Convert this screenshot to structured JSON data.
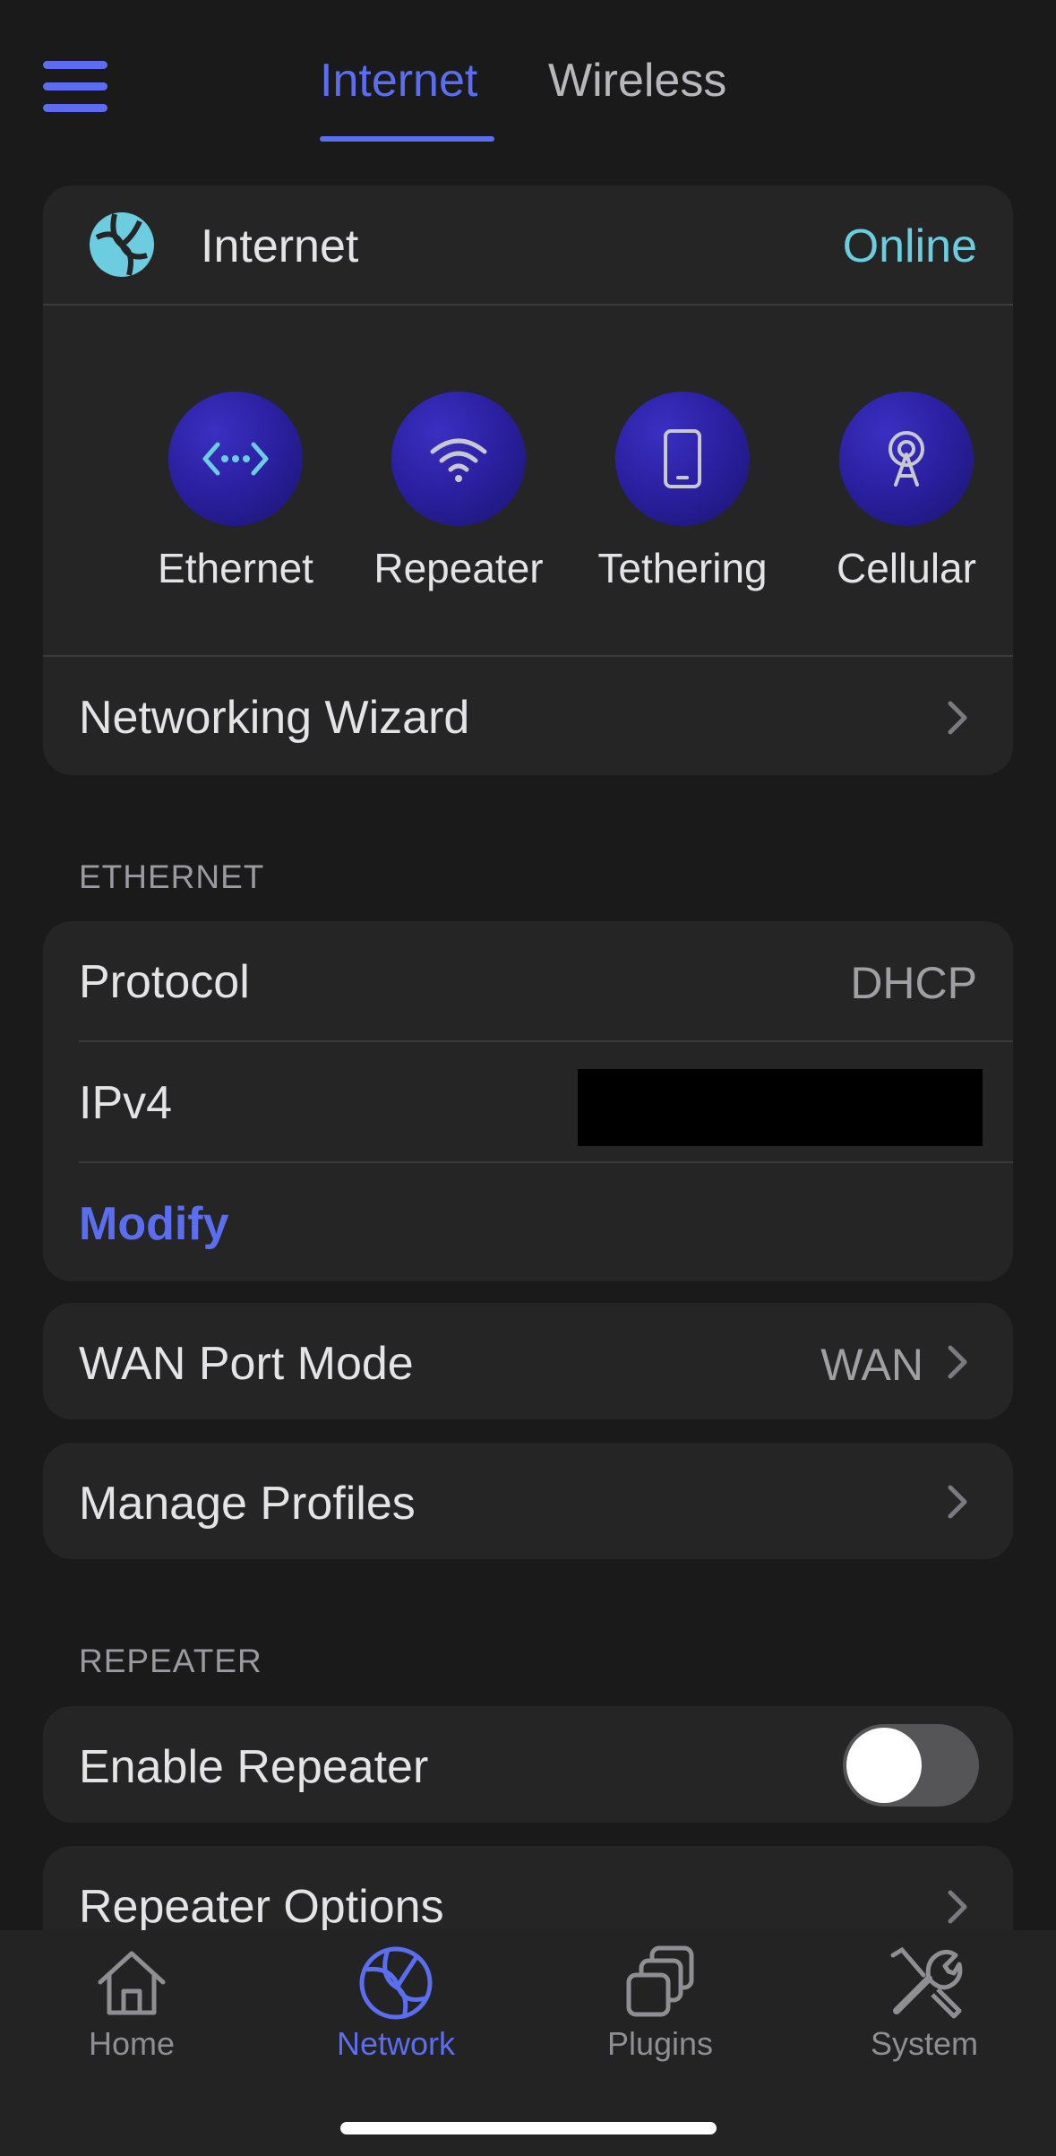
{
  "header": {
    "tabs": [
      {
        "label": "Internet",
        "active": true
      },
      {
        "label": "Wireless",
        "active": false
      }
    ]
  },
  "internet_card": {
    "title": "Internet",
    "status": "Online",
    "status_color": "#6ccde0",
    "modes": [
      {
        "label": "Ethernet",
        "icon": "ethernet-icon"
      },
      {
        "label": "Repeater",
        "icon": "wifi-icon"
      },
      {
        "label": "Tethering",
        "icon": "phone-icon"
      },
      {
        "label": "Cellular",
        "icon": "cellular-tower-icon"
      }
    ],
    "wizard_label": "Networking Wizard"
  },
  "ethernet_section": {
    "header": "ETHERNET",
    "protocol_label": "Protocol",
    "protocol_value": "DHCP",
    "ipv4_label": "IPv4",
    "modify_label": "Modify"
  },
  "wan_port": {
    "label": "WAN Port Mode",
    "value": "WAN"
  },
  "manage_profiles": {
    "label": "Manage Profiles"
  },
  "repeater_section": {
    "header": "REPEATER",
    "enable_label": "Enable Repeater",
    "enable_on": false,
    "options_label": "Repeater Options"
  },
  "tabbar": {
    "items": [
      {
        "label": "Home",
        "icon": "home-icon",
        "active": false
      },
      {
        "label": "Network",
        "icon": "globe-icon",
        "active": true
      },
      {
        "label": "Plugins",
        "icon": "plugins-icon",
        "active": false
      },
      {
        "label": "System",
        "icon": "tools-icon",
        "active": false
      }
    ]
  },
  "colors": {
    "accent": "#5c6ef0",
    "background": "#1a1a1b",
    "card": "#252526"
  }
}
